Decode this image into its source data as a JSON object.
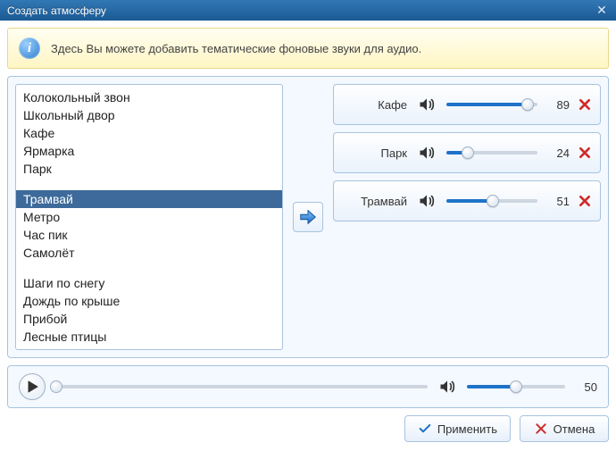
{
  "window": {
    "title": "Создать атмосферу"
  },
  "info": {
    "text": "Здесь Вы можете добавить тематические фоновые звуки для аудио."
  },
  "list": {
    "groups": [
      [
        "Колокольный звон",
        "Школьный двор",
        "Кафе",
        "Ярмарка",
        "Парк"
      ],
      [
        "Трамвай",
        "Метро",
        "Час пик",
        "Самолёт"
      ],
      [
        "Шаги по снегу",
        "Дождь по крыше",
        "Прибой",
        "Лесные птицы"
      ]
    ],
    "selected": "Трамвай"
  },
  "tracks": [
    {
      "name": "Кафе",
      "volume": 89
    },
    {
      "name": "Парк",
      "volume": 24
    },
    {
      "name": "Трамвай",
      "volume": 51
    }
  ],
  "player": {
    "position": 0,
    "volume": 50
  },
  "buttons": {
    "apply": "Применить",
    "cancel": "Отмена"
  }
}
